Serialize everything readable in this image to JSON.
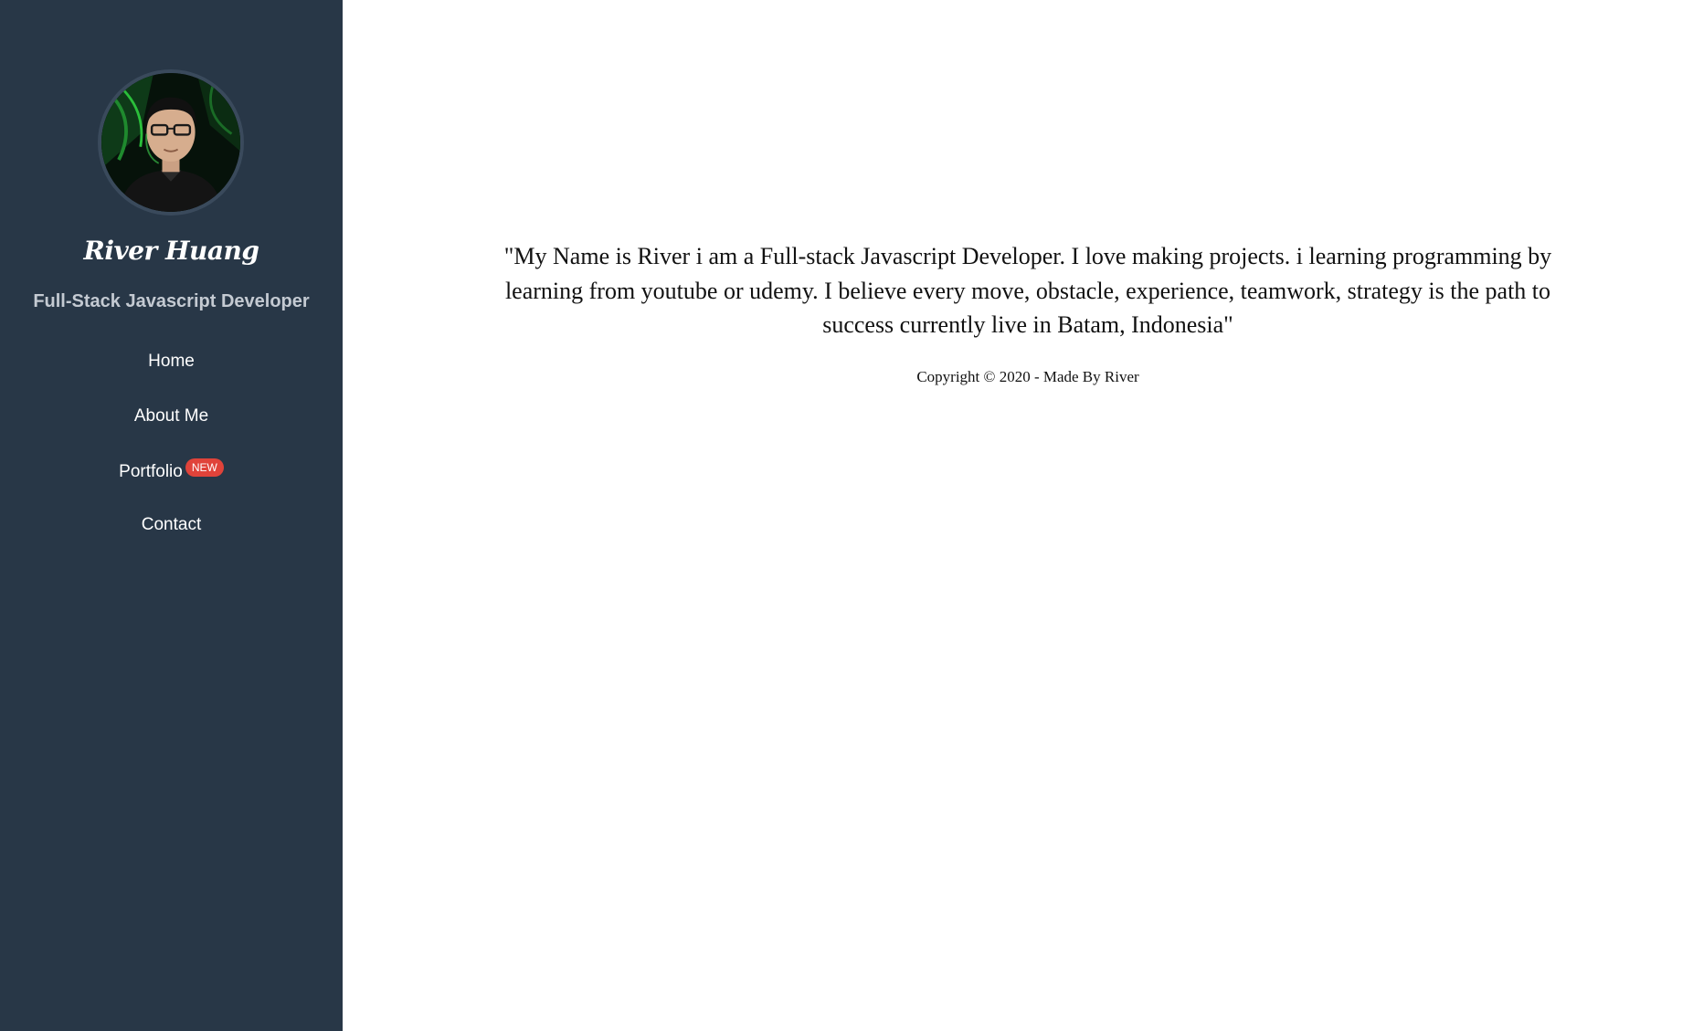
{
  "sidebar": {
    "name": "River Huang",
    "role": "Full-Stack Javascript Developer",
    "nav": [
      {
        "label": "Home"
      },
      {
        "label": "About Me"
      },
      {
        "label": "Portfolio",
        "badge": "NEW"
      },
      {
        "label": "Contact"
      }
    ]
  },
  "main": {
    "quote": "\"My Name is River i am a Full-stack Javascript Developer. I love making projects. i learning programming by learning from youtube or udemy. I believe every move, obstacle, experience, teamwork, strategy is the path to success currently live in Batam, Indonesia\"",
    "copyright": "Copyright © 2020 - Made By River"
  },
  "colors": {
    "sidebar_bg": "#283747",
    "badge_bg": "#e0433a",
    "text_dark": "#111111"
  }
}
